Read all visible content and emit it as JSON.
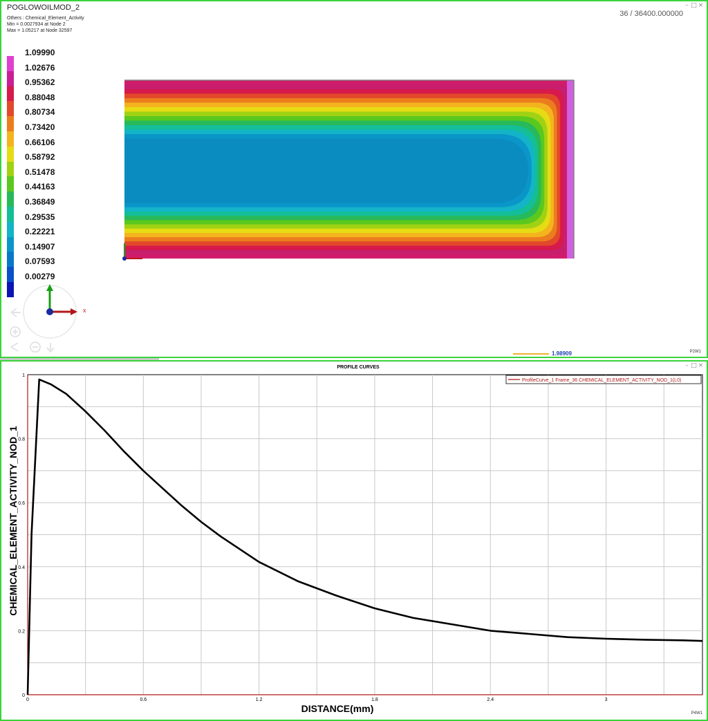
{
  "top": {
    "title": "POGLOWOILMOD_2",
    "meta": [
      "Others :  Chemical_Element_Activity",
      "Min = 0.0027934  at  Node  2",
      "Max = 1.05217  at  Node  32597"
    ],
    "frame_info": "36  /  36400.000000",
    "legend_labels": [
      "1.09990",
      "1.02676",
      "0.95362",
      "0.88048",
      "0.80734",
      "0.73420",
      "0.66106",
      "0.58792",
      "0.51478",
      "0.44163",
      "0.36849",
      "0.29535",
      "0.22221",
      "0.14907",
      "0.07593",
      "0.00279"
    ],
    "legend_colors": [
      "#e040d0",
      "#c81e96",
      "#d7194b",
      "#e2482a",
      "#ec7d1e",
      "#f4b41e",
      "#e6dc14",
      "#a0d214",
      "#5ac81e",
      "#28b95a",
      "#14be96",
      "#14b4c8",
      "#0a96c8",
      "#0a78c8",
      "#0a50c8",
      "#0a14b4"
    ],
    "triad_axis_label": "x",
    "scale_value": "1.98909",
    "viewport_tag": "P2W1"
  },
  "chart_data": {
    "type": "line",
    "title": "PROFILE CURVES",
    "xlabel": "DISTANCE(mm)",
    "ylabel": "CHEMICAL_ELEMENT_ACTIVITY_NOD_1",
    "xlim": [
      0,
      3.5
    ],
    "ylim": [
      0,
      1
    ],
    "xticks": [
      0,
      0.6,
      1.2,
      1.8,
      2.4,
      3
    ],
    "xtick_labels": [
      "0",
      "0.6",
      "1.2",
      "1.8",
      "2.4",
      "3"
    ],
    "yticks": [
      0,
      0.2,
      0.4,
      0.6,
      0.8,
      1
    ],
    "ytick_labels": [
      "0",
      "0.2",
      "0.4",
      "0.6",
      "0.8",
      "1"
    ],
    "grid": true,
    "legend_position": "top-right",
    "series": [
      {
        "name": "ProfileCurve_1 Frame_36 CHEMICAL_ELEMENT_ACTIVITY_NOD_1(L0)",
        "color": "#000000",
        "x": [
          0.0,
          0.02,
          0.06,
          0.12,
          0.2,
          0.3,
          0.4,
          0.5,
          0.6,
          0.7,
          0.8,
          0.9,
          1.0,
          1.2,
          1.4,
          1.6,
          1.8,
          2.0,
          2.2,
          2.4,
          2.6,
          2.8,
          3.0,
          3.2,
          3.4,
          3.5
        ],
        "y": [
          0.0,
          0.5,
          0.985,
          0.97,
          0.94,
          0.885,
          0.825,
          0.76,
          0.7,
          0.645,
          0.59,
          0.54,
          0.495,
          0.415,
          0.355,
          0.31,
          0.27,
          0.24,
          0.22,
          0.2,
          0.19,
          0.18,
          0.175,
          0.172,
          0.17,
          0.168
        ]
      }
    ]
  },
  "bottom": {
    "viewport_tag": "P4W1"
  }
}
